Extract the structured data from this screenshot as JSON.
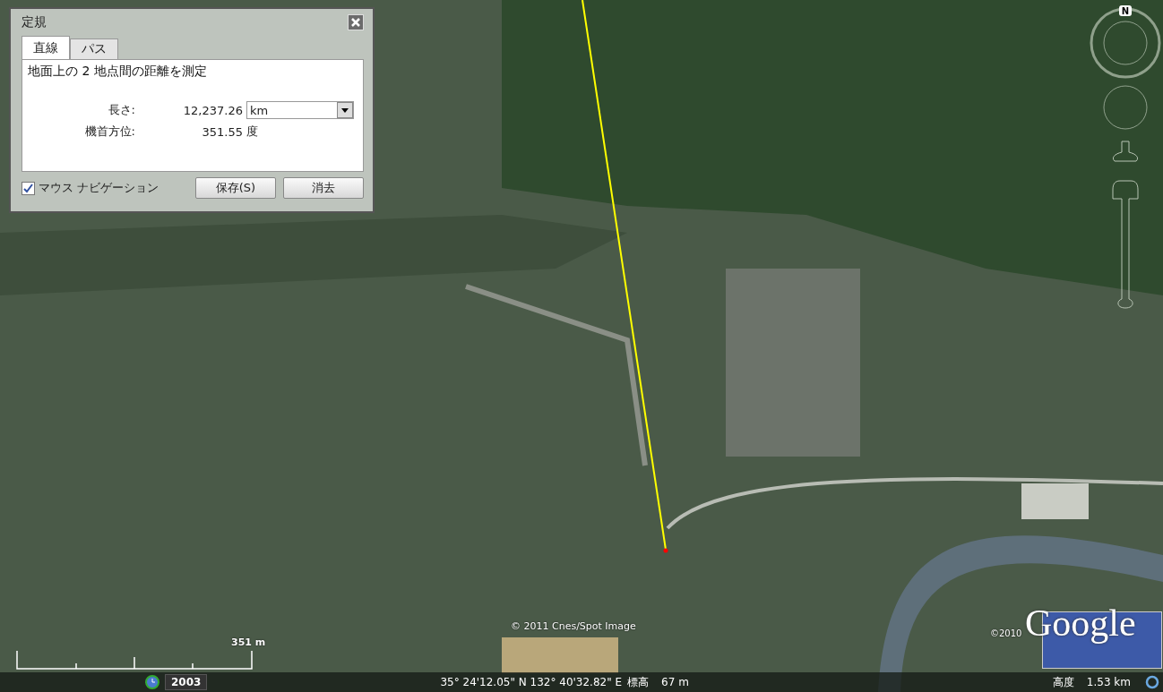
{
  "dialog": {
    "title": "定規",
    "tabs": [
      {
        "label": "直線",
        "selected": true
      },
      {
        "label": "パス",
        "selected": false
      }
    ],
    "description": "地面上の 2 地点間の距離を測定",
    "fields": [
      {
        "label": "長さ:",
        "value": "12,237.26",
        "unit": "km",
        "kind": "select"
      },
      {
        "label": "機首方位:",
        "value": "351.55",
        "unit": "度",
        "kind": "text"
      }
    ],
    "mouse_navigation": {
      "label": "マウス ナビゲーション",
      "checked": true
    },
    "buttons": [
      "保存(S)",
      "消去"
    ]
  },
  "compass": {
    "north": "N"
  },
  "scale": {
    "label": "351 m"
  },
  "copyright": "© 2011 Cnes/Spot Image",
  "logo": {
    "year": "©2010",
    "name": "Google"
  },
  "status_bar": {
    "year": "2003",
    "coords": "35° 24'12.05\" N 132° 40'32.82\" E",
    "elevation_label": "標高",
    "elevation": "67 m",
    "altitude_label": "高度",
    "altitude": "1.53 km"
  }
}
